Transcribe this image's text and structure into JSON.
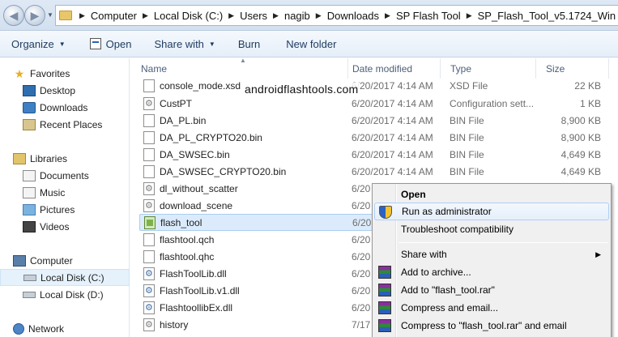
{
  "address": {
    "crumbs": [
      "Computer",
      "Local Disk (C:)",
      "Users",
      "nagib",
      "Downloads",
      "SP Flash Tool",
      "SP_Flash_Tool_v5.1724_Win"
    ]
  },
  "toolbar": {
    "organize": "Organize",
    "open": "Open",
    "share_with": "Share with",
    "burn": "Burn",
    "new_folder": "New folder"
  },
  "nav": {
    "favorites": "Favorites",
    "desktop": "Desktop",
    "downloads": "Downloads",
    "recent": "Recent Places",
    "libraries": "Libraries",
    "documents": "Documents",
    "music": "Music",
    "pictures": "Pictures",
    "videos": "Videos",
    "computer": "Computer",
    "disk_c": "Local Disk (C:)",
    "disk_d": "Local Disk (D:)",
    "network": "Network"
  },
  "columns": {
    "name": "Name",
    "date": "Date modified",
    "type": "Type",
    "size": "Size"
  },
  "watermark": "androidflashtools.com",
  "files": [
    {
      "name": "console_mode.xsd",
      "date": "6/20/2017 4:14 AM",
      "type": "XSD File",
      "size": "22 KB",
      "icon": "file-icon"
    },
    {
      "name": "CustPT",
      "date": "6/20/2017 4:14 AM",
      "type": "Configuration sett...",
      "size": "1 KB",
      "icon": "config-file-icon"
    },
    {
      "name": "DA_PL.bin",
      "date": "6/20/2017 4:14 AM",
      "type": "BIN File",
      "size": "8,900 KB",
      "icon": "file-icon"
    },
    {
      "name": "DA_PL_CRYPTO20.bin",
      "date": "6/20/2017 4:14 AM",
      "type": "BIN File",
      "size": "8,900 KB",
      "icon": "file-icon"
    },
    {
      "name": "DA_SWSEC.bin",
      "date": "6/20/2017 4:14 AM",
      "type": "BIN File",
      "size": "4,649 KB",
      "icon": "file-icon"
    },
    {
      "name": "DA_SWSEC_CRYPTO20.bin",
      "date": "6/20/2017 4:14 AM",
      "type": "BIN File",
      "size": "4,649 KB",
      "icon": "file-icon"
    },
    {
      "name": "dl_without_scatter",
      "date": "6/20",
      "type": "",
      "size": "",
      "icon": "config-file-icon"
    },
    {
      "name": "download_scene",
      "date": "6/20",
      "type": "",
      "size": "",
      "icon": "config-file-icon"
    },
    {
      "name": "flash_tool",
      "date": "6/20",
      "type": "",
      "size": "",
      "icon": "application-icon"
    },
    {
      "name": "flashtool.qch",
      "date": "6/20",
      "type": "",
      "size": "",
      "icon": "file-icon"
    },
    {
      "name": "flashtool.qhc",
      "date": "6/20",
      "type": "",
      "size": "",
      "icon": "file-icon"
    },
    {
      "name": "FlashToolLib.dll",
      "date": "6/20",
      "type": "",
      "size": "",
      "icon": "dll-file-icon"
    },
    {
      "name": "FlashToolLib.v1.dll",
      "date": "6/20",
      "type": "",
      "size": "",
      "icon": "dll-file-icon"
    },
    {
      "name": "FlashtoollibEx.dll",
      "date": "6/20",
      "type": "",
      "size": "",
      "icon": "dll-file-icon"
    },
    {
      "name": "history",
      "date": "7/17",
      "type": "",
      "size": "",
      "icon": "config-file-icon"
    }
  ],
  "context_menu": {
    "open": "Open",
    "run_as_admin": "Run as administrator",
    "troubleshoot": "Troubleshoot compatibility",
    "share_with": "Share with",
    "add_archive": "Add to archive...",
    "add_rar": "Add to \"flash_tool.rar\"",
    "compress_email": "Compress and email...",
    "compress_rar_email": "Compress to \"flash_tool.rar\" and email"
  }
}
